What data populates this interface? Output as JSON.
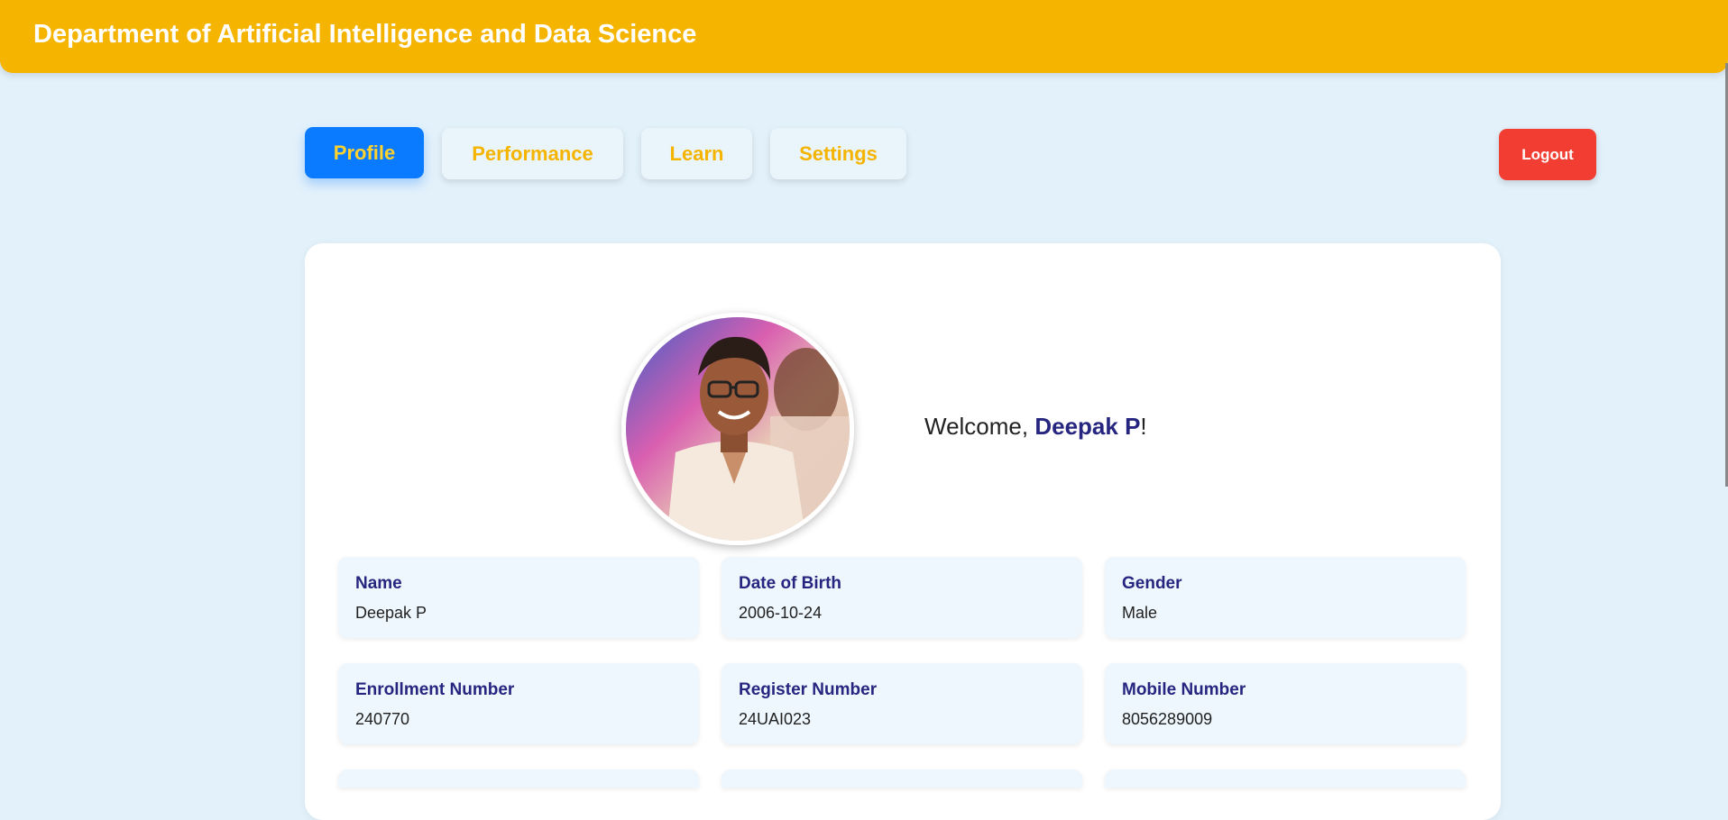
{
  "header": {
    "title": "Department of Artificial Intelligence and Data Science"
  },
  "nav": {
    "tabs": [
      {
        "label": "Profile",
        "active": true
      },
      {
        "label": "Performance",
        "active": false
      },
      {
        "label": "Learn",
        "active": false
      },
      {
        "label": "Settings",
        "active": false
      }
    ],
    "logout_label": "Logout"
  },
  "profile": {
    "welcome_prefix": "Welcome, ",
    "user_name": "Deepak P",
    "welcome_suffix": "!",
    "fields": [
      {
        "label": "Name",
        "value": "Deepak P"
      },
      {
        "label": "Date of Birth",
        "value": "2006-10-24"
      },
      {
        "label": "Gender",
        "value": "Male"
      },
      {
        "label": "Enrollment Number",
        "value": "240770"
      },
      {
        "label": "Register Number",
        "value": "24UAI023"
      },
      {
        "label": "Mobile Number",
        "value": "8056289009"
      }
    ]
  },
  "colors": {
    "header_bg": "#f5b400",
    "active_tab_bg": "#0a7bff",
    "tab_text": "#f5b400",
    "logout_bg": "#f23d33",
    "label_text": "#262680",
    "page_bg": "#e3f1fb"
  }
}
